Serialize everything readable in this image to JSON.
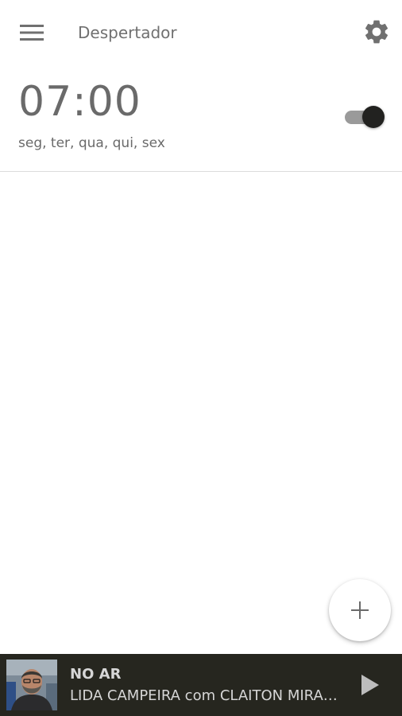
{
  "app_bar": {
    "title": "Despertador",
    "menu_icon": "hamburger-menu-icon",
    "settings_icon": "gear-icon"
  },
  "alarms": [
    {
      "time": "07:00",
      "days": "seg, ter, qua, qui, sex",
      "enabled": true
    }
  ],
  "fab": {
    "icon": "plus-icon"
  },
  "player": {
    "status_label": "NO AR",
    "show_title": "LIDA CAMPEIRA com CLAITON MIRANDA",
    "thumbnail": "host-photo",
    "play_icon": "play-icon"
  },
  "colors": {
    "background": "#ffffff",
    "text_gray": "#6a6a6a",
    "toggle_thumb": "#222220",
    "player_bar": "#26261f"
  }
}
